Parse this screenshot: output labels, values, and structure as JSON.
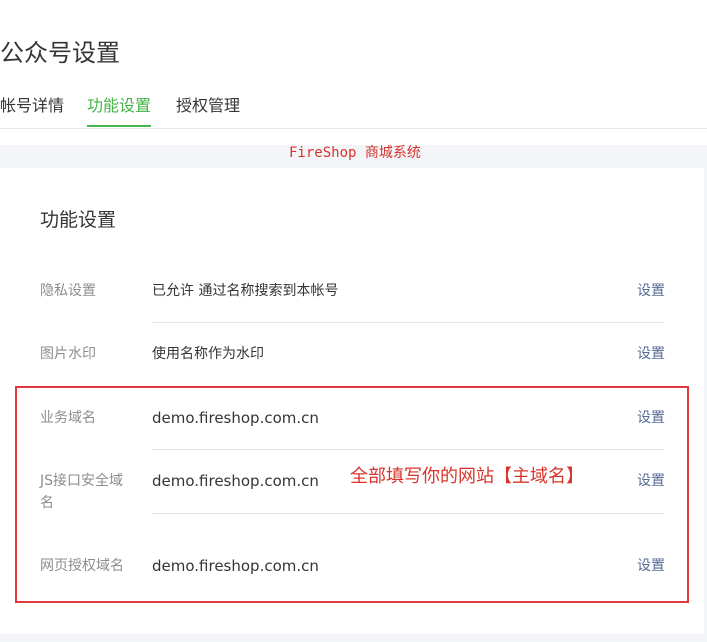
{
  "header": {
    "title": "公众号设置",
    "tabs": [
      {
        "label": "帐号详情",
        "active": false
      },
      {
        "label": "功能设置",
        "active": true
      },
      {
        "label": "授权管理",
        "active": false
      }
    ]
  },
  "section": {
    "title": "功能设置",
    "rows": [
      {
        "label": "隐私设置",
        "value": "已允许 通过名称搜索到本帐号",
        "action": "设置"
      },
      {
        "label": "图片水印",
        "value": "使用名称作为水印",
        "action": "设置"
      },
      {
        "label": "业务域名",
        "value": "demo.fireshop.com.cn",
        "action": "设置"
      },
      {
        "label": "JS接口安全域名",
        "value": "demo.fireshop.com.cn",
        "action": "设置"
      },
      {
        "label": "网页授权域名",
        "value": "demo.fireshop.com.cn",
        "action": "设置"
      }
    ]
  },
  "overlay": {
    "watermark": "FireShop 商城系统",
    "annotation": "全部填写你的网站【主域名】"
  },
  "colors": {
    "accent": "#44b549",
    "link": "#576b95",
    "annotation_red": "#e0393e"
  }
}
